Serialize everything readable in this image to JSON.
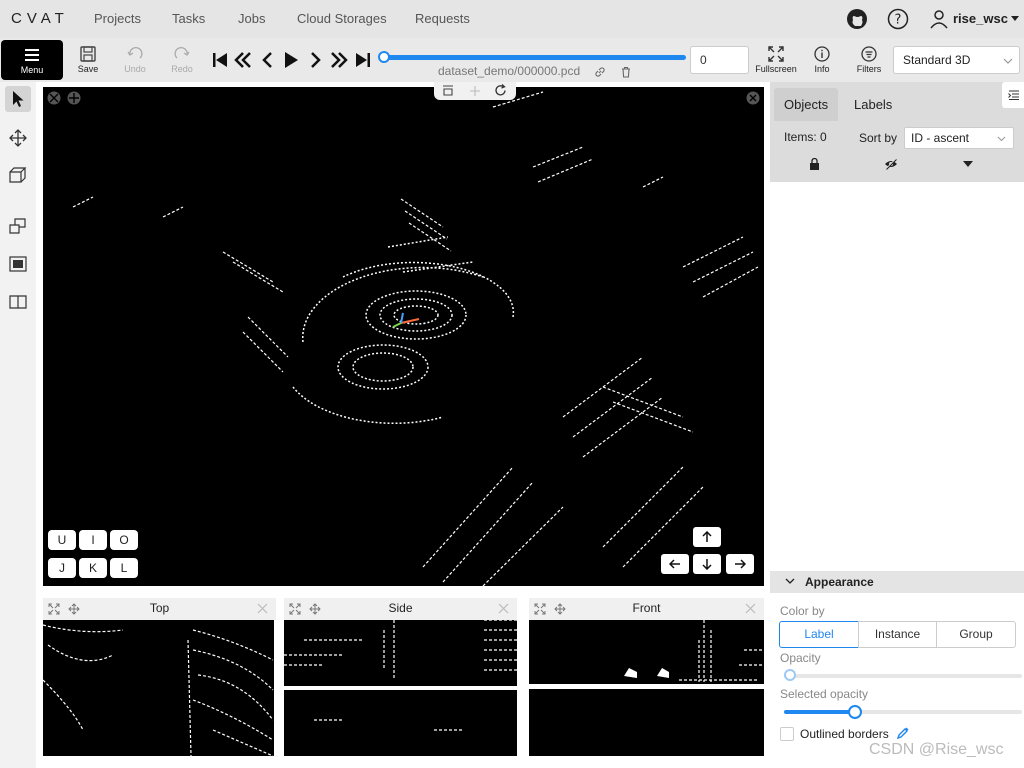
{
  "topnav": {
    "logo": "CVAT",
    "links": [
      "Projects",
      "Tasks",
      "Jobs",
      "Cloud Storages",
      "Requests"
    ],
    "user": "rise_wsc"
  },
  "toolbar": {
    "menu_label": "Menu",
    "save_label": "Save",
    "undo_label": "Undo",
    "redo_label": "Redo",
    "frame_name": "dataset_demo/000000.pcd",
    "frame_number": "0",
    "fullscreen_label": "Fullscreen",
    "info_label": "Info",
    "filters_label": "Filters",
    "workspace": "Standard 3D"
  },
  "canvas": {
    "keys_top": [
      "U",
      "I",
      "O"
    ],
    "keys_bottom": [
      "J",
      "K",
      "L"
    ]
  },
  "views": {
    "top": "Top",
    "side": "Side",
    "front": "Front"
  },
  "sidebar": {
    "tab_objects": "Objects",
    "tab_labels": "Labels",
    "items_count": "Items: 0",
    "sort_by_label": "Sort by",
    "sort_value": "ID - ascent",
    "appearance_title": "Appearance",
    "color_by_label": "Color by",
    "color_by_options": [
      "Label",
      "Instance",
      "Group"
    ],
    "color_by_selected": "Label",
    "opacity_label": "Opacity",
    "opacity_value": 0,
    "selected_opacity_label": "Selected opacity",
    "selected_opacity_value": 0.3,
    "outlined_borders_label": "Outlined borders"
  },
  "watermark": "CSDN @Rise_wsc",
  "colors": {
    "accent": "#1f88f0",
    "canvas_bg": "#000000"
  }
}
